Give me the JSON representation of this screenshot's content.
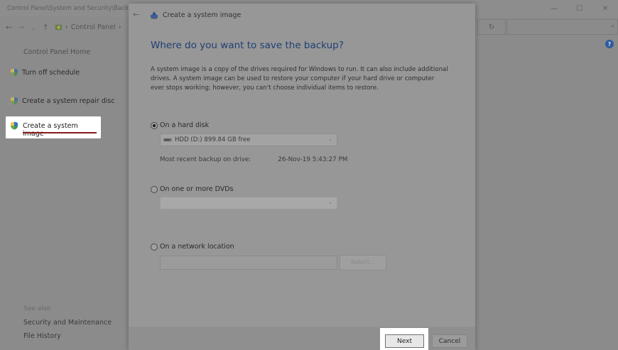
{
  "background_window": {
    "title": "Control Panel\\System and Security\\Backup and Restore",
    "breadcrumb_label": "Control Panel",
    "breadcrumb_sep": "›",
    "sidebar": {
      "home": "Control Panel Home",
      "items": [
        {
          "label": "Turn off schedule"
        },
        {
          "label": "Create a system image"
        },
        {
          "label": "Create a system repair disc"
        }
      ],
      "see_also": "See also",
      "links": [
        {
          "label": "Security and Maintenance"
        },
        {
          "label": "File History"
        }
      ]
    },
    "search_placeholder": ""
  },
  "dialog": {
    "title": "Create a system image",
    "heading": "Where do you want to save the backup?",
    "description": "A system image is a copy of the drives required for Windows to run. It can also include additional drives. A system image can be used to restore your computer if your hard drive or computer ever stops working; however, you can't choose individual items to restore.",
    "options": {
      "hard_disk": {
        "label": "On a hard disk",
        "selected": true,
        "drive": "HDD (D:)  899.84 GB free",
        "recent_label": "Most recent backup on drive:",
        "recent_value": "26-Nov-19 5:43:27 PM"
      },
      "dvd": {
        "label": "On one or more DVDs",
        "selected": false,
        "drive": ""
      },
      "network": {
        "label": "On a network location",
        "selected": false,
        "path": "",
        "select_button": "Select..."
      }
    },
    "buttons": {
      "next": "Next",
      "cancel": "Cancel"
    }
  },
  "colors": {
    "heading": "#1f3f73",
    "highlight": "#ffffff",
    "underline": "#8b1a1a"
  }
}
